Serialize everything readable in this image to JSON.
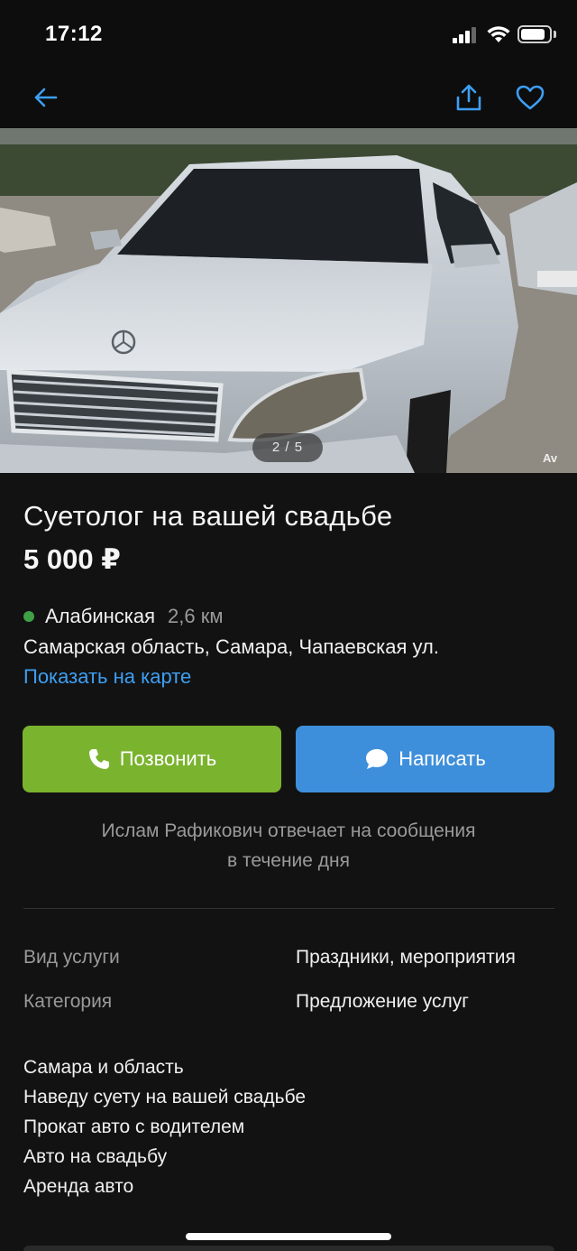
{
  "status_bar": {
    "time": "17:12"
  },
  "nav": {
    "back_icon": "arrow-left-icon",
    "share_icon": "share-icon",
    "favorite_icon": "heart-icon",
    "accent_color": "#3d9ff3"
  },
  "photo": {
    "counter": "2 / 5",
    "watermark": "Av"
  },
  "listing": {
    "title": "Суетолог на вашей свадьбе",
    "price": "5 000 ₽",
    "metro_station": "Алабинская",
    "metro_distance": "2,6 км",
    "metro_color": "#3fa046",
    "address": "Самарская область, Самара, Чапаевская ул.",
    "map_link": "Показать на карте"
  },
  "actions": {
    "call_label": "Позвонить",
    "call_color": "#7ab32e",
    "message_label": "Написать",
    "message_color": "#3e8fdb"
  },
  "seller_note": {
    "line1": "Ислам Рафикович отвечает на сообщения",
    "line2": "в течение дня"
  },
  "params": [
    {
      "label": "Вид услуги",
      "value": "Праздники, мероприятия"
    },
    {
      "label": "Категория",
      "value": "Предложение услуг"
    }
  ],
  "description": [
    "Самара и область",
    "Наведу суету на вашей свадьбе",
    "Прокат авто с водителем",
    "Авто на свадьбу",
    "Аренда авто"
  ]
}
